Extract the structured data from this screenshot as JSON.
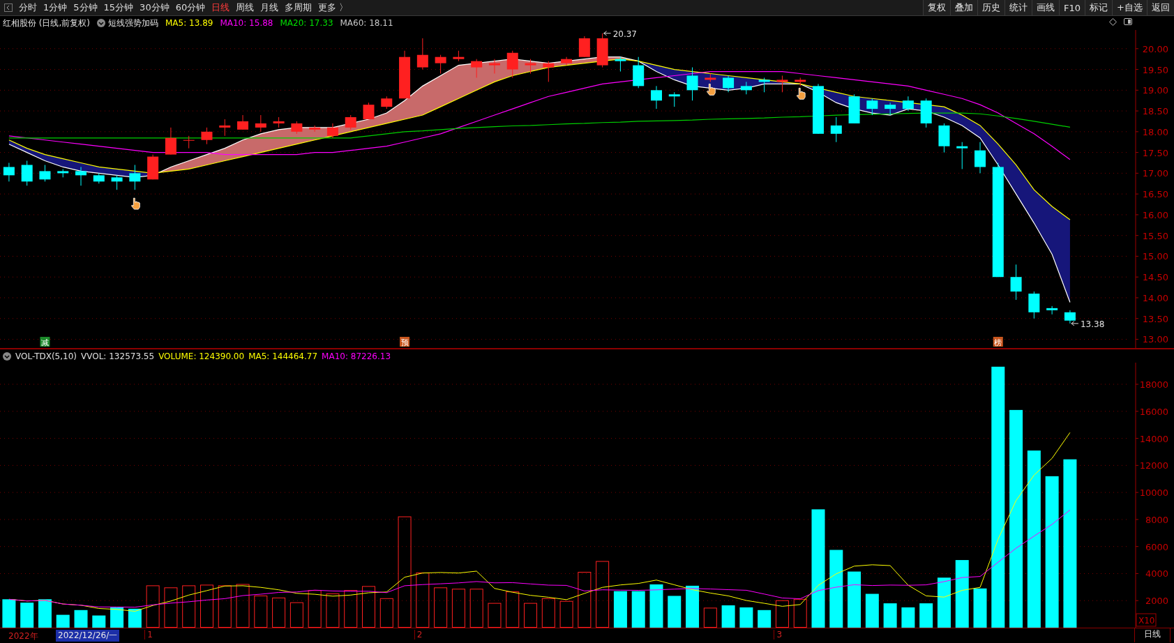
{
  "toolbar": {
    "periods": [
      {
        "label": "分时",
        "selected": false
      },
      {
        "label": "1分钟",
        "selected": false
      },
      {
        "label": "5分钟",
        "selected": false
      },
      {
        "label": "15分钟",
        "selected": false
      },
      {
        "label": "30分钟",
        "selected": false
      },
      {
        "label": "60分钟",
        "selected": false
      },
      {
        "label": "日线",
        "selected": true
      },
      {
        "label": "周线",
        "selected": false
      },
      {
        "label": "月线",
        "selected": false
      },
      {
        "label": "多周期",
        "selected": false
      },
      {
        "label": "更多 〉",
        "selected": false
      }
    ],
    "buttons": [
      "复权",
      "叠加",
      "历史",
      "统计",
      "画线",
      "F10",
      "标记",
      "+自选",
      "返回"
    ]
  },
  "price_panel": {
    "title": "红相股份 (日线,前复权)",
    "indicator": "短线强势加码",
    "legend": [
      {
        "label": "MA5: 13.89",
        "color": "#ffff00"
      },
      {
        "label": "MA10: 15.88",
        "color": "#ff00ff"
      },
      {
        "label": "MA20: 17.33",
        "color": "#00e000"
      },
      {
        "label": "MA60: 18.11",
        "color": "#c8c8c8"
      }
    ],
    "axis_labels": [
      "20.00",
      "19.50",
      "19.00",
      "18.50",
      "18.00",
      "17.50",
      "17.00",
      "16.50",
      "16.00",
      "15.50",
      "15.00",
      "14.50",
      "14.00",
      "13.50",
      "13.00"
    ],
    "high_label": "20.37",
    "low_label": "13.38",
    "tags": [
      {
        "label": "减",
        "color": "#1c8a2a"
      },
      {
        "label": "预",
        "color": "#c8561e"
      },
      {
        "label": "榜",
        "color": "#c8561e"
      }
    ]
  },
  "volume_panel": {
    "title": "VOL-TDX(5,10)",
    "legend": [
      {
        "label": "VVOL: 132573.55",
        "color": "#e0e0e0"
      },
      {
        "label": "VOLUME: 124390.00",
        "color": "#ffff00"
      },
      {
        "label": "MA5: 144464.77",
        "color": "#ffff00"
      },
      {
        "label": "MA10: 87226.13",
        "color": "#ff00ff"
      }
    ],
    "axis_labels": [
      "18000",
      "16000",
      "14000",
      "12000",
      "10000",
      "8000",
      "6000",
      "4000",
      "2000"
    ],
    "unit_label": "X10"
  },
  "date_axis": {
    "year_label": "2022年",
    "cursor_date": "2022/12/26/一",
    "month_labels": [
      "1",
      "2",
      "3"
    ],
    "period_label": "日线"
  }
}
